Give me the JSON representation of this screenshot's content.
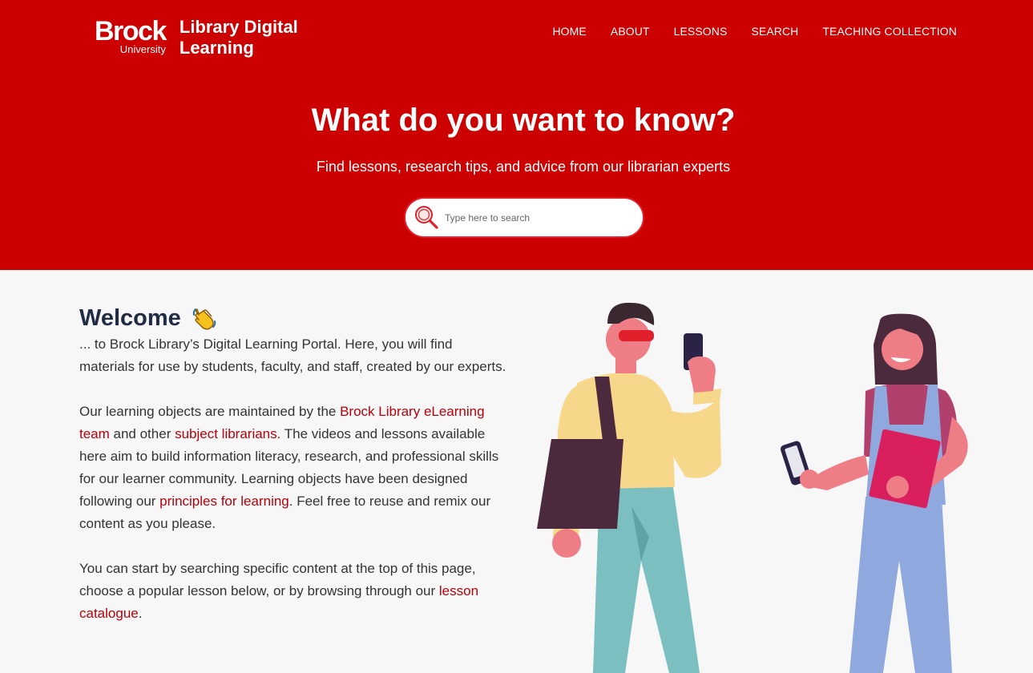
{
  "brand": {
    "logo_word": "Brock",
    "logo_sub": "University",
    "site_title": "Library Digital Learning"
  },
  "nav": {
    "home": "HOME",
    "about": "ABOUT",
    "lessons": "LESSONS",
    "search": "SEARCH",
    "teaching": "TEACHING COLLECTION"
  },
  "hero": {
    "title": "What do you want to know?",
    "subtitle": "Find lessons, research tips, and advice from our librarian experts",
    "search_placeholder": "Type here to search"
  },
  "welcome": {
    "heading": "Welcome",
    "p1": "... to Brock Library’s Digital Learning Portal. Here, you will find materials for use by students, faculty, and staff, created by our experts.",
    "p2_a": "Our learning objects are maintained by the ",
    "p2_link1": "Brock Library eLearning team",
    "p2_b": " and other ",
    "p2_link2": "subject librarians.",
    "p2_c": " The videos and lessons available here aim to build information literacy, research, and professional skills for our learner community. Learning objects have been designed following our ",
    "p2_link3": "principles for learning",
    "p2_d": ". Feel free to reuse and remix our content as you please.",
    "p3_a": "You can start by searching specific content at the top of this page, choose a popular lesson below, or by browsing through our ",
    "p3_link": "lesson catalogue",
    "p3_b": "."
  },
  "colors": {
    "brand_red": "#cc0000",
    "link_red": "#b8000a",
    "heading": "#222b45"
  }
}
